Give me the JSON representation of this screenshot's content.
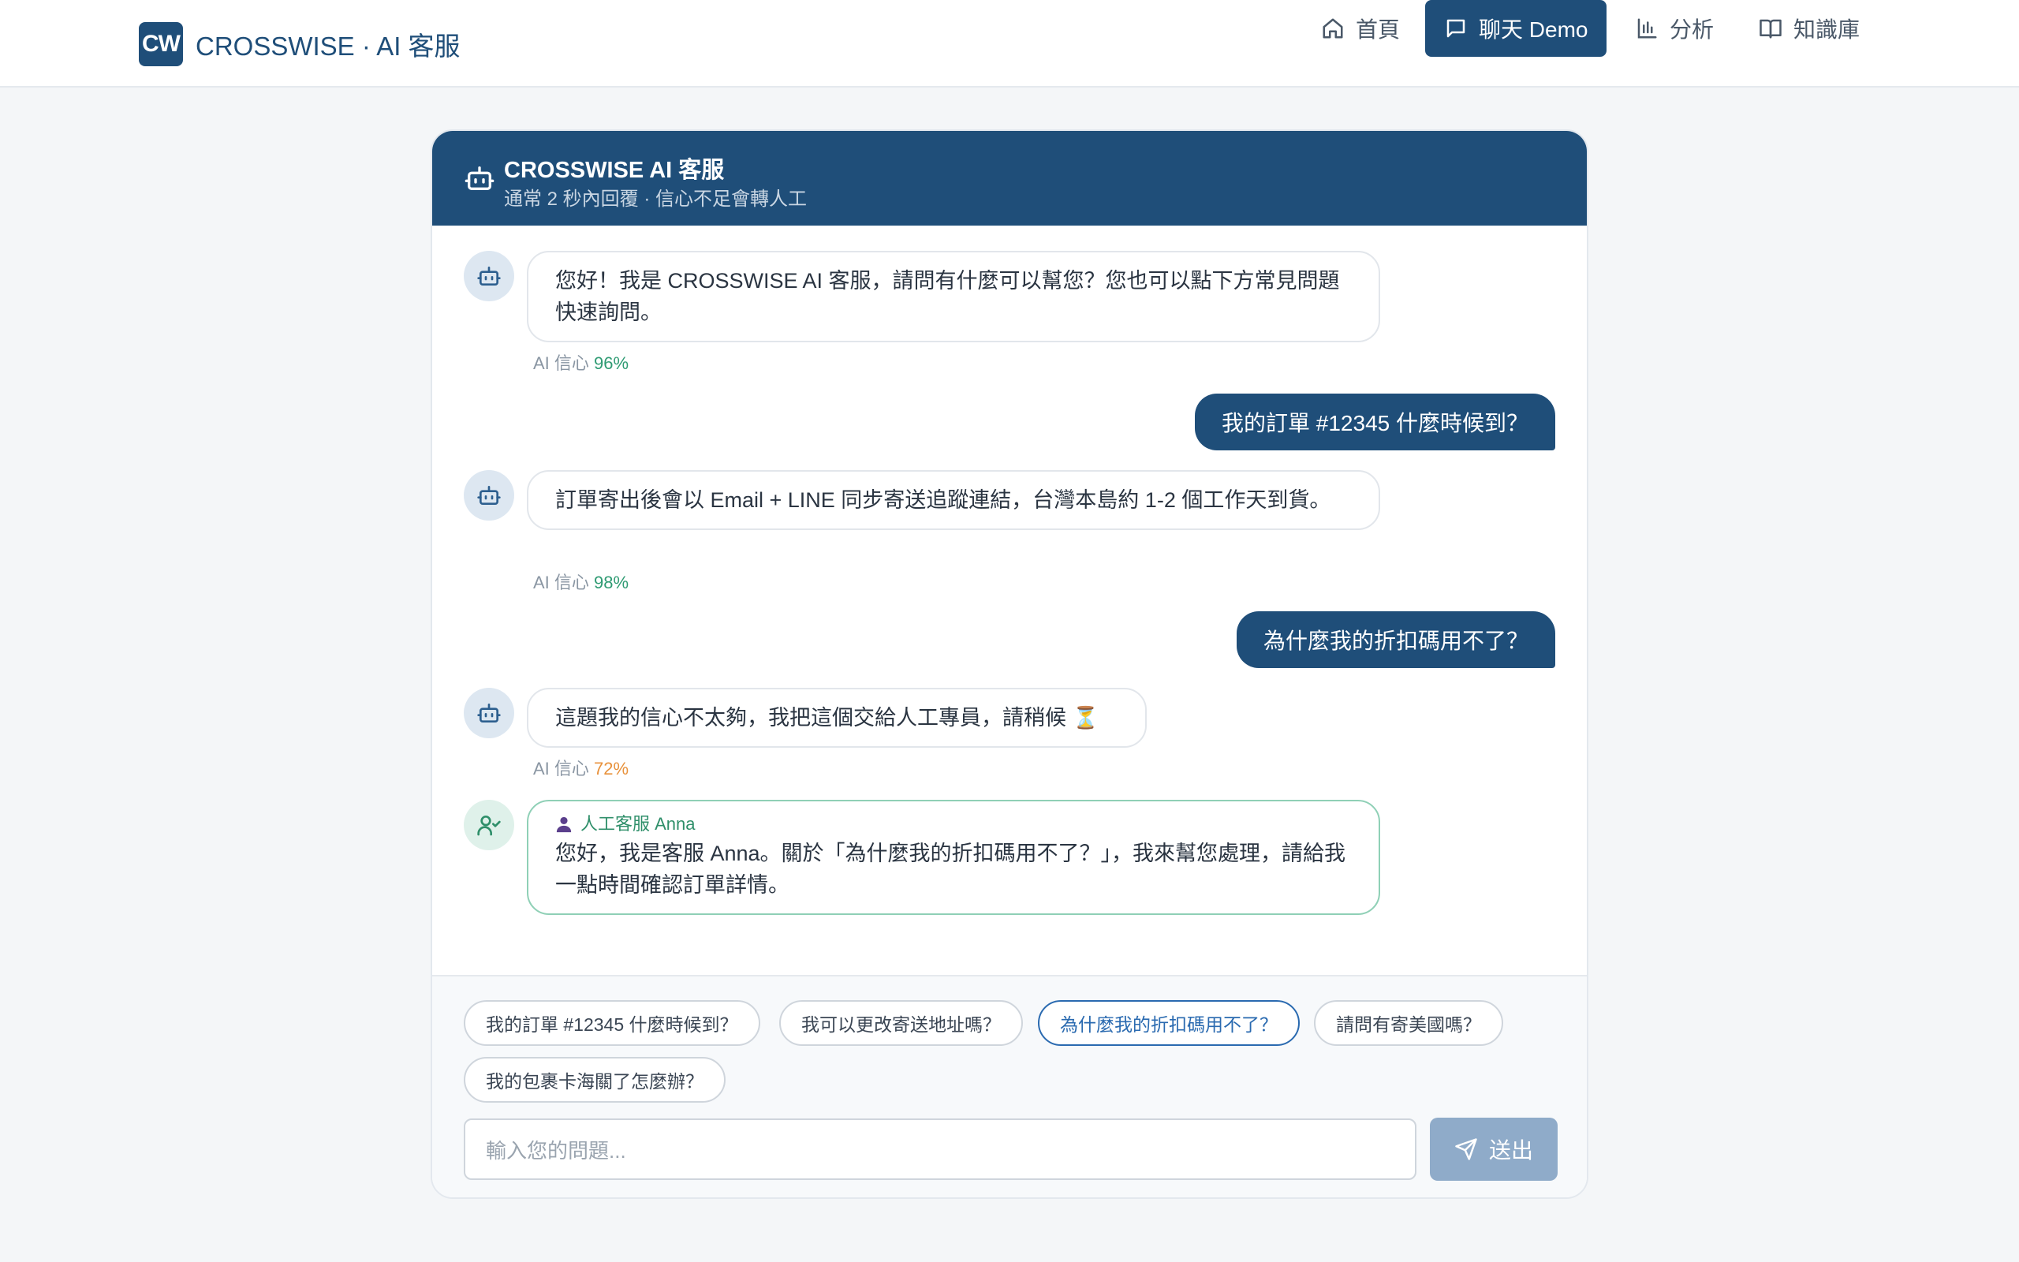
{
  "brand": {
    "logo": "CW",
    "name": "CROSSWISE · AI 客服"
  },
  "nav": [
    {
      "label": "首頁",
      "icon": "home-icon"
    },
    {
      "label": "聊天 Demo",
      "icon": "chat-icon",
      "active": true
    },
    {
      "label": "分析",
      "icon": "bar-chart-icon"
    },
    {
      "label": "知識庫",
      "icon": "book-icon"
    }
  ],
  "chat": {
    "title": "CROSSWISE AI 客服",
    "subtitle": "通常 2 秒內回覆 · 信心不足會轉人工",
    "messages": [
      {
        "role": "bot",
        "text": "您好！我是 CROSSWISE AI 客服，請問有什麼可以幫您？您也可以點下方常見問題快速詢問。",
        "confidence_label": "AI 信心",
        "confidence": "96%"
      },
      {
        "role": "user",
        "text": "我的訂單 #12345 什麼時候到？"
      },
      {
        "role": "bot",
        "text": "訂單寄出後會以 Email + LINE 同步寄送追蹤連結，台灣本島約 1-2 個工作天到貨。",
        "confidence_label": "AI 信心",
        "confidence": "98%"
      },
      {
        "role": "user",
        "text": "為什麼我的折扣碼用不了？"
      },
      {
        "role": "bot",
        "text": "這題我的信心不太夠，我把這個交給人工專員，請稍候 ⏳",
        "confidence_label": "AI 信心",
        "confidence": "72%"
      },
      {
        "role": "human",
        "agent": "人工客服 Anna",
        "text": "您好，我是客服 Anna。關於「為什麼我的折扣碼用不了？」，我來幫您處理，請給我一點時間確認訂單詳情。"
      }
    ]
  },
  "quick_replies": [
    "我的訂單 #12345 什麼時候到？",
    "我可以更改寄送地址嗎？",
    "為什麼我的折扣碼用不了？",
    "請問有寄美國嗎？",
    "我的包裹卡海關了怎麼辦？"
  ],
  "selected_quick_reply": "為什麼我的折扣碼用不了？",
  "composer": {
    "placeholder": "輸入您的問題...",
    "send_label": "送出"
  },
  "colors": {
    "primary": "#1f4e79",
    "confidence_high": "#2f9b73",
    "confidence_mid": "#e8923c",
    "human_border": "#8fd0b6"
  }
}
